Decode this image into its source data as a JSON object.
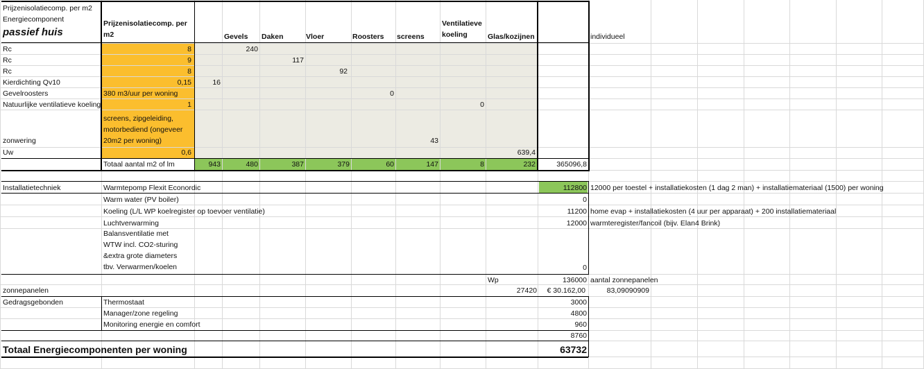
{
  "header": {
    "title1": "Prijzenisolatiecomp. per m2",
    "title2": "Energiecomponent",
    "project": "passief huis",
    "col_label_1": "Prijzenisolatiecomp. per",
    "col_label_2": "m2",
    "cols": [
      "Gevels",
      "Daken",
      "Vloer",
      "Roosters",
      "screens"
    ],
    "vent1": "Ventilatieve",
    "vent2": "koeling",
    "glas": "Glas/kozijnen",
    "individueel": "individueel"
  },
  "rows": [
    {
      "label": "Rc",
      "price": "8",
      "value": "240"
    },
    {
      "label": "Rc",
      "price": "9",
      "value": "117"
    },
    {
      "label": "Rc",
      "price": "8",
      "value": "92"
    },
    {
      "label": "Kierdichting Qv10",
      "price": "0,15",
      "value": "16"
    },
    {
      "label": "Gevelroosters",
      "price": "380 m3/uur per woning",
      "value": "0"
    },
    {
      "label": "Natuurlijke ventilatieve koeling",
      "price": "1",
      "value": "0"
    },
    {
      "label": "zonwering",
      "price_lines": [
        "screens, zipgeleiding,",
        "motorbediend (ongeveer",
        "20m2 per woning)"
      ],
      "value": "43"
    },
    {
      "label": "Uw",
      "price": "0,6",
      "value": "639,4"
    }
  ],
  "totals": {
    "label": "Totaal aantal m2 of lm",
    "values": [
      "943",
      "480",
      "387",
      "379",
      "60",
      "147",
      "8",
      "232"
    ],
    "sum": "365096,8"
  },
  "install": {
    "section": "Installatietechniek",
    "items": [
      {
        "name": "Warmtepomp Flexit Econordic",
        "value": "112800",
        "note": "12000 per toestel + installatiekosten (1 dag 2 man) + installatiemateriaal (1500) per woning"
      },
      {
        "name": "Warm water (PV boiler)",
        "value": "0",
        "note": ""
      },
      {
        "name": "Koeling (L/L WP koelregister op toevoer ventilatie)",
        "value": "11200",
        "note": "home evap + installatiekosten (4 uur per apparaat) + 200 installatiemateriaal"
      },
      {
        "name": "Luchtverwarming",
        "value": "12000",
        "note": "warmteregister/fancoil (bijv. Elan4 Brink)"
      }
    ],
    "balans_lines": [
      "Balansventilatie met",
      "WTW incl. CO2-sturing",
      "&extra grote diameters",
      "tbv. Verwarmen/koelen"
    ],
    "balans_value": "0"
  },
  "solar": {
    "wp_label": "Wp",
    "wp_value": "136000",
    "wp_note": "aantal zonnepanelen",
    "label": "zonnepanelen",
    "amount": "27420",
    "euro": "€ 30.162,00",
    "count": "83,09090909"
  },
  "behav": {
    "section": "Gedragsgebonden",
    "items": [
      {
        "name": "Thermostaat",
        "value": "3000"
      },
      {
        "name": "Manager/zone regeling",
        "value": "4800"
      },
      {
        "name": "Monitoring energie en comfort",
        "value": "960"
      }
    ],
    "sum": "8760"
  },
  "grand": {
    "label": "Totaal Energiecomponenten per woning",
    "value": "63732"
  },
  "colors": {
    "orange": "#FBBE2E",
    "beige": "#ECEBE3",
    "green": "#8CC65A",
    "grid": "#d9d9d9"
  }
}
